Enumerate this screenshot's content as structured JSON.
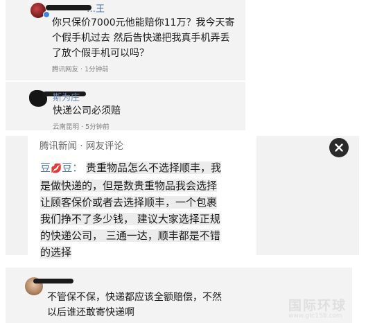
{
  "comments": [
    {
      "username": "…王",
      "text_lines": [
        "你只保价7000元他能赔你11万？我今天寄",
        "个假手机过去 然后告快递把我真手机弄丢",
        "了放个假手机可以吗？"
      ],
      "source": "腾讯网友",
      "time": "1分钟前"
    },
    {
      "username": "斯为庄",
      "text": "快递公司必须赔",
      "source": "云南昆明",
      "time": "5分钟前"
    }
  ],
  "featured": {
    "header": "腾讯新闻 · 网友评论",
    "user_prefix": "豆",
    "user_suffix": "豆：",
    "emoji": "💋",
    "lines": [
      "贵重物品怎么不选择顺丰，我",
      "是做快递的，但是数贵重物品我会选择",
      "让顾客保价或者去选择顺丰，一个包裹",
      "我们挣不了多少钱， 建议大家选择正规",
      "的快递公司， 三通一达，顺丰都是不错",
      "的选择"
    ],
    "close_icon": "close-icon"
  },
  "bottom_comment": {
    "lines": [
      "不管保不保，快递都应该全额赔偿，不然",
      "以后谁还敢寄快递啊"
    ]
  },
  "watermark": {
    "title": "国际环球",
    "url": "www.gtc158.com"
  },
  "colors": {
    "panel_bg": "#f3f3f3",
    "highlight": "#ececec",
    "username": "#4a6fa5",
    "close_button": "#2b2b2b"
  }
}
